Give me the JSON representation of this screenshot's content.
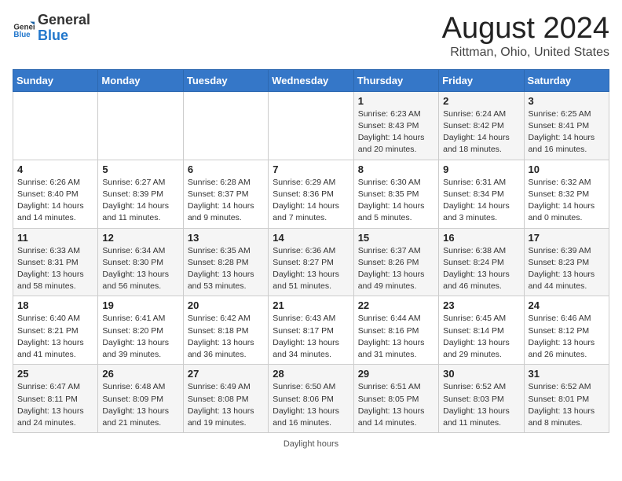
{
  "header": {
    "logo_general": "General",
    "logo_blue": "Blue",
    "month_year": "August 2024",
    "location": "Rittman, Ohio, United States"
  },
  "days_of_week": [
    "Sunday",
    "Monday",
    "Tuesday",
    "Wednesday",
    "Thursday",
    "Friday",
    "Saturday"
  ],
  "weeks": [
    [
      {
        "day": "",
        "info": ""
      },
      {
        "day": "",
        "info": ""
      },
      {
        "day": "",
        "info": ""
      },
      {
        "day": "",
        "info": ""
      },
      {
        "day": "1",
        "info": "Sunrise: 6:23 AM\nSunset: 8:43 PM\nDaylight: 14 hours and 20 minutes."
      },
      {
        "day": "2",
        "info": "Sunrise: 6:24 AM\nSunset: 8:42 PM\nDaylight: 14 hours and 18 minutes."
      },
      {
        "day": "3",
        "info": "Sunrise: 6:25 AM\nSunset: 8:41 PM\nDaylight: 14 hours and 16 minutes."
      }
    ],
    [
      {
        "day": "4",
        "info": "Sunrise: 6:26 AM\nSunset: 8:40 PM\nDaylight: 14 hours and 14 minutes."
      },
      {
        "day": "5",
        "info": "Sunrise: 6:27 AM\nSunset: 8:39 PM\nDaylight: 14 hours and 11 minutes."
      },
      {
        "day": "6",
        "info": "Sunrise: 6:28 AM\nSunset: 8:37 PM\nDaylight: 14 hours and 9 minutes."
      },
      {
        "day": "7",
        "info": "Sunrise: 6:29 AM\nSunset: 8:36 PM\nDaylight: 14 hours and 7 minutes."
      },
      {
        "day": "8",
        "info": "Sunrise: 6:30 AM\nSunset: 8:35 PM\nDaylight: 14 hours and 5 minutes."
      },
      {
        "day": "9",
        "info": "Sunrise: 6:31 AM\nSunset: 8:34 PM\nDaylight: 14 hours and 3 minutes."
      },
      {
        "day": "10",
        "info": "Sunrise: 6:32 AM\nSunset: 8:32 PM\nDaylight: 14 hours and 0 minutes."
      }
    ],
    [
      {
        "day": "11",
        "info": "Sunrise: 6:33 AM\nSunset: 8:31 PM\nDaylight: 13 hours and 58 minutes."
      },
      {
        "day": "12",
        "info": "Sunrise: 6:34 AM\nSunset: 8:30 PM\nDaylight: 13 hours and 56 minutes."
      },
      {
        "day": "13",
        "info": "Sunrise: 6:35 AM\nSunset: 8:28 PM\nDaylight: 13 hours and 53 minutes."
      },
      {
        "day": "14",
        "info": "Sunrise: 6:36 AM\nSunset: 8:27 PM\nDaylight: 13 hours and 51 minutes."
      },
      {
        "day": "15",
        "info": "Sunrise: 6:37 AM\nSunset: 8:26 PM\nDaylight: 13 hours and 49 minutes."
      },
      {
        "day": "16",
        "info": "Sunrise: 6:38 AM\nSunset: 8:24 PM\nDaylight: 13 hours and 46 minutes."
      },
      {
        "day": "17",
        "info": "Sunrise: 6:39 AM\nSunset: 8:23 PM\nDaylight: 13 hours and 44 minutes."
      }
    ],
    [
      {
        "day": "18",
        "info": "Sunrise: 6:40 AM\nSunset: 8:21 PM\nDaylight: 13 hours and 41 minutes."
      },
      {
        "day": "19",
        "info": "Sunrise: 6:41 AM\nSunset: 8:20 PM\nDaylight: 13 hours and 39 minutes."
      },
      {
        "day": "20",
        "info": "Sunrise: 6:42 AM\nSunset: 8:18 PM\nDaylight: 13 hours and 36 minutes."
      },
      {
        "day": "21",
        "info": "Sunrise: 6:43 AM\nSunset: 8:17 PM\nDaylight: 13 hours and 34 minutes."
      },
      {
        "day": "22",
        "info": "Sunrise: 6:44 AM\nSunset: 8:16 PM\nDaylight: 13 hours and 31 minutes."
      },
      {
        "day": "23",
        "info": "Sunrise: 6:45 AM\nSunset: 8:14 PM\nDaylight: 13 hours and 29 minutes."
      },
      {
        "day": "24",
        "info": "Sunrise: 6:46 AM\nSunset: 8:12 PM\nDaylight: 13 hours and 26 minutes."
      }
    ],
    [
      {
        "day": "25",
        "info": "Sunrise: 6:47 AM\nSunset: 8:11 PM\nDaylight: 13 hours and 24 minutes."
      },
      {
        "day": "26",
        "info": "Sunrise: 6:48 AM\nSunset: 8:09 PM\nDaylight: 13 hours and 21 minutes."
      },
      {
        "day": "27",
        "info": "Sunrise: 6:49 AM\nSunset: 8:08 PM\nDaylight: 13 hours and 19 minutes."
      },
      {
        "day": "28",
        "info": "Sunrise: 6:50 AM\nSunset: 8:06 PM\nDaylight: 13 hours and 16 minutes."
      },
      {
        "day": "29",
        "info": "Sunrise: 6:51 AM\nSunset: 8:05 PM\nDaylight: 13 hours and 14 minutes."
      },
      {
        "day": "30",
        "info": "Sunrise: 6:52 AM\nSunset: 8:03 PM\nDaylight: 13 hours and 11 minutes."
      },
      {
        "day": "31",
        "info": "Sunrise: 6:52 AM\nSunset: 8:01 PM\nDaylight: 13 hours and 8 minutes."
      }
    ]
  ],
  "footer": {
    "daylight_hours_label": "Daylight hours"
  }
}
